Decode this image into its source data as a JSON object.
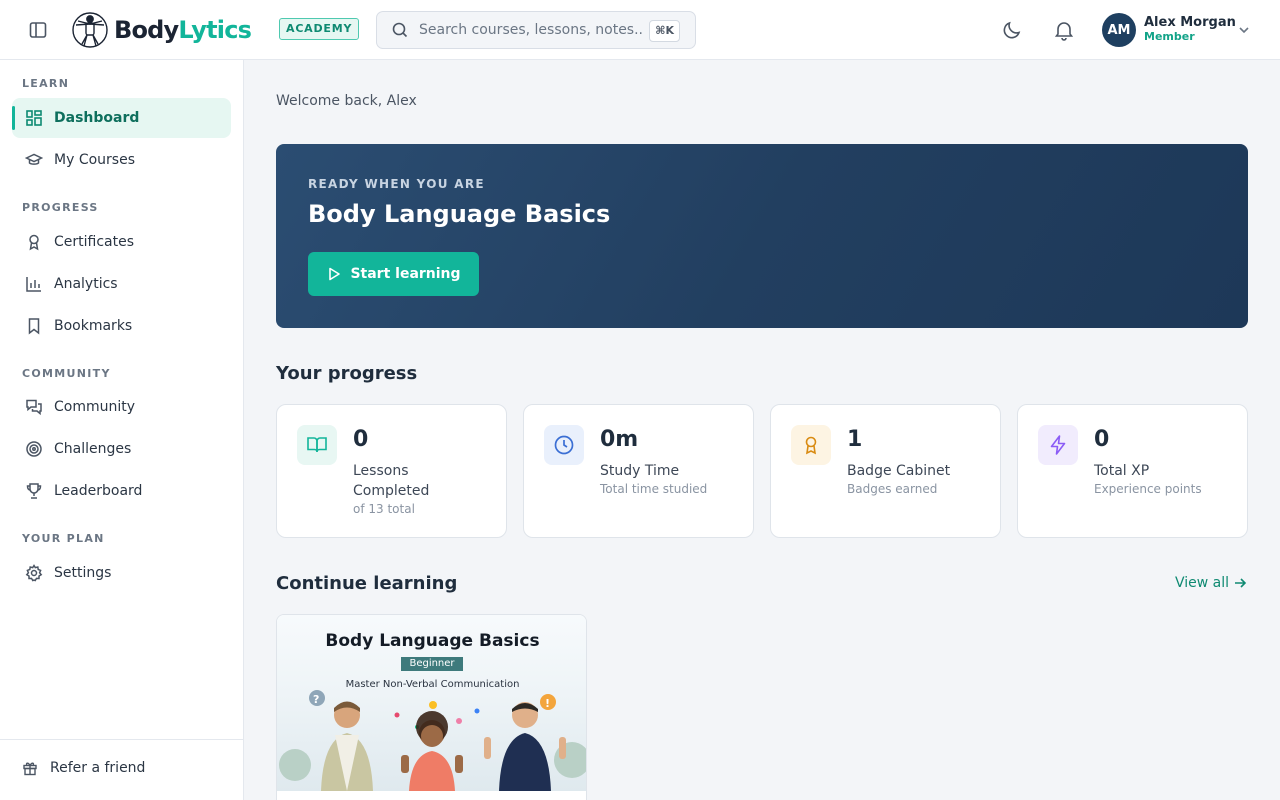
{
  "header": {
    "brand_part1": "Body",
    "brand_part2": "Lytics",
    "badge": "ACADEMY",
    "search_placeholder": "Search courses, lessons, notes...",
    "search_shortcut": "⌘K",
    "user_initials": "AM",
    "user_name": "Alex Morgan",
    "user_role": "Member"
  },
  "sidebar": {
    "sections": [
      "LEARN",
      "PROGRESS",
      "COMMUNITY",
      "YOUR PLAN"
    ],
    "items": [
      {
        "label": "Dashboard",
        "icon": "grid-icon",
        "active": true
      },
      {
        "label": "My Courses",
        "icon": "graduation-cap-icon"
      },
      {
        "label": "Certificates",
        "icon": "award-icon"
      },
      {
        "label": "Analytics",
        "icon": "bar-chart-icon"
      },
      {
        "label": "Bookmarks",
        "icon": "bookmark-icon"
      },
      {
        "label": "Community",
        "icon": "chat-icon"
      },
      {
        "label": "Challenges",
        "icon": "target-icon"
      },
      {
        "label": "Leaderboard",
        "icon": "trophy-icon"
      },
      {
        "label": "Settings",
        "icon": "gear-icon"
      }
    ],
    "footer_label": "Refer a friend"
  },
  "main": {
    "welcome": "Welcome back, Alex",
    "hero": {
      "kicker": "READY WHEN YOU ARE",
      "title": "Body Language Basics",
      "button": "Start learning"
    },
    "progress_title": "Your progress",
    "stats": [
      {
        "value": "0",
        "label": "Lessons Completed",
        "sub": "of 13 total",
        "color": "#12b59a"
      },
      {
        "value": "0m",
        "label": "Study Time",
        "sub": "Total time studied",
        "color": "#3b6fd4"
      },
      {
        "value": "1",
        "label": "Badge Cabinet",
        "sub": "Badges earned",
        "color": "#d98b12"
      },
      {
        "value": "0",
        "label": "Total XP",
        "sub": "Experience points",
        "color": "#8b5cf6"
      }
    ],
    "continue_title": "Continue learning",
    "view_all": "View all",
    "course": {
      "thumb_title": "Body Language Basics",
      "thumb_level": "Beginner",
      "thumb_subtitle": "Master Non-Verbal Communication"
    }
  },
  "colors": {
    "accent": "#12b59a",
    "hero_bg": "#223f60"
  }
}
